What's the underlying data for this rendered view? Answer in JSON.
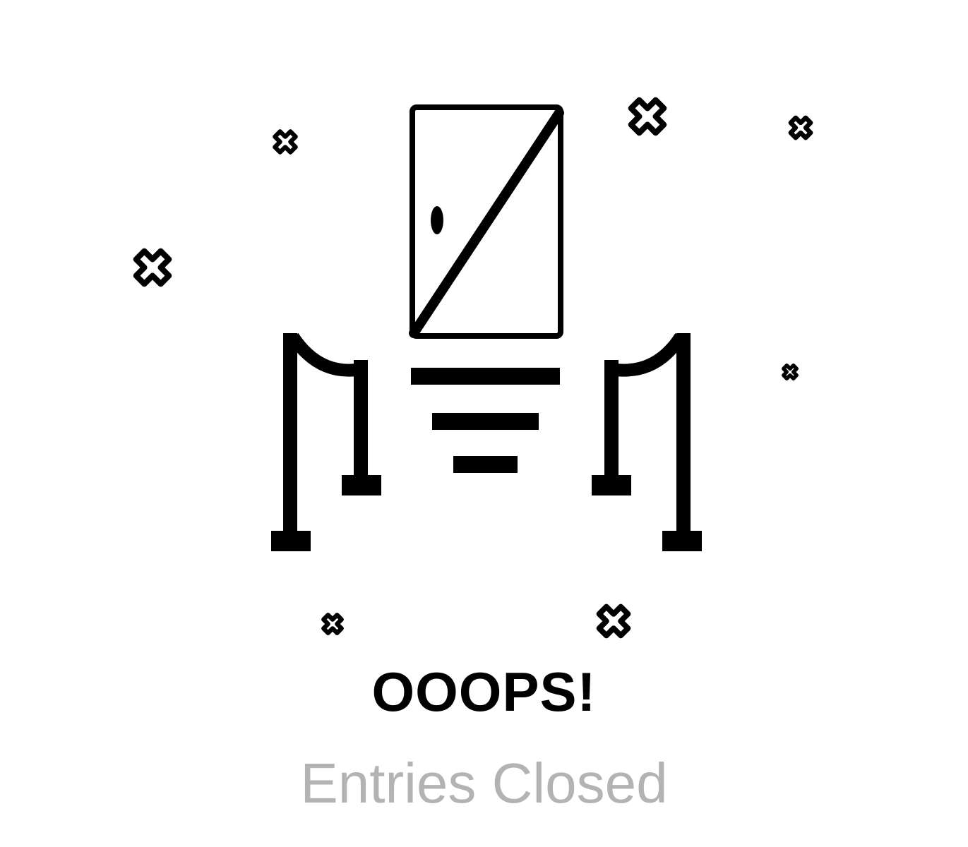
{
  "message": {
    "title": "OOOPS!",
    "subtitle": "Entries Closed"
  },
  "illustration": {
    "icon": "closed-door-with-rope-barriers-icon",
    "decor_icon": "cross-sparkle-icon"
  },
  "colors": {
    "background": "#ffffff",
    "ink": "#000000",
    "subtitle": "#b3b3b3"
  }
}
